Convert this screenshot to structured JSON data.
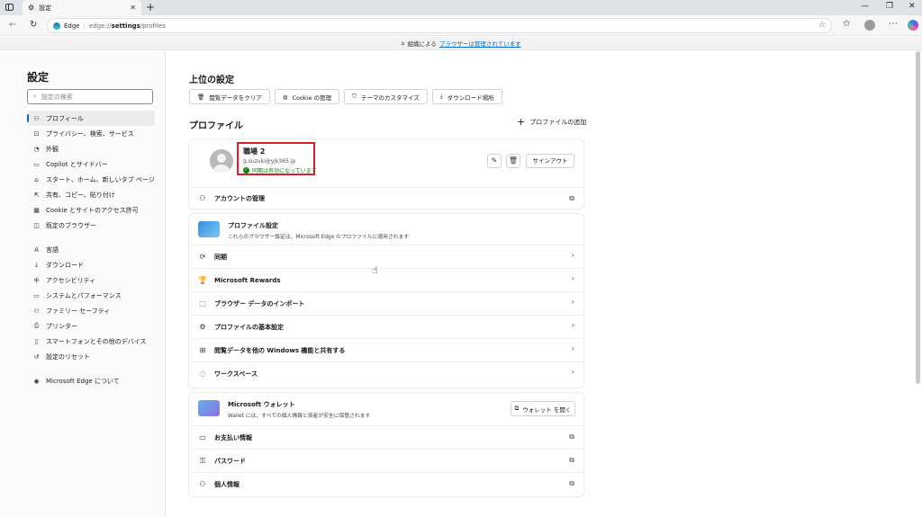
{
  "browser": {
    "tab_title": "設定",
    "tab_close": "✕",
    "new_tab": "+",
    "window_controls": [
      "—",
      "❐",
      "✕"
    ],
    "address": {
      "site": "Edge",
      "url_prefix": "edge://",
      "url_bold": "settings",
      "url_suffix": "/profiles"
    }
  },
  "banner": {
    "prefix": "組織による",
    "link": "ブラウザーは管理されています"
  },
  "sidebar": {
    "title": "設定",
    "search_placeholder": "設定の検索",
    "items": [
      {
        "label": "プロフィール",
        "icon": "person-icon",
        "glyph": "⚇",
        "active": true
      },
      {
        "label": "プライバシー、検索、サービス",
        "icon": "lock-icon",
        "glyph": "⊡"
      },
      {
        "label": "外観",
        "icon": "palette-icon",
        "glyph": "◔"
      },
      {
        "label": "Copilot とサイドバー",
        "icon": "sidebar-icon",
        "glyph": "▭"
      },
      {
        "label": "スタート、ホーム、新しいタブ ページ",
        "icon": "home-icon",
        "glyph": "⌂"
      },
      {
        "label": "共有、コピー、貼り付け",
        "icon": "share-icon",
        "glyph": "⇱"
      },
      {
        "label": "Cookie とサイトのアクセス許可",
        "icon": "permissions-icon",
        "glyph": "▦"
      },
      {
        "label": "既定のブラウザー",
        "icon": "browser-icon",
        "glyph": "◫"
      },
      {
        "label": "言語",
        "icon": "language-icon",
        "glyph": "A",
        "gap_before": true
      },
      {
        "label": "ダウンロード",
        "icon": "download-icon",
        "glyph": "⤓"
      },
      {
        "label": "アクセシビリティ",
        "icon": "accessibility-icon",
        "glyph": "✣"
      },
      {
        "label": "システムとパフォーマンス",
        "icon": "laptop-icon",
        "glyph": "▭"
      },
      {
        "label": "ファミリー セーフティ",
        "icon": "family-icon",
        "glyph": "⚇"
      },
      {
        "label": "プリンター",
        "icon": "printer-icon",
        "glyph": "⎙"
      },
      {
        "label": "スマートフォンとその他のデバイス",
        "icon": "phone-icon",
        "glyph": "▯"
      },
      {
        "label": "設定のリセット",
        "icon": "reset-icon",
        "glyph": "↺"
      },
      {
        "label": "Microsoft Edge について",
        "icon": "edge-icon",
        "glyph": "◉",
        "gap_before": true
      }
    ]
  },
  "main": {
    "top_settings_title": "上位の設定",
    "quick_buttons": [
      {
        "label": "閲覧データをクリア",
        "glyph": "🗑"
      },
      {
        "label": "Cookie の管理",
        "glyph": "◍"
      },
      {
        "label": "テーマのカスタマイズ",
        "glyph": "⛉"
      },
      {
        "label": "ダウンロード場所",
        "glyph": "⤓"
      }
    ],
    "profiles_title": "プロファイル",
    "add_profile": "プロファイルの追加",
    "profile": {
      "name": "職場 2",
      "email": "g.suzuki@yjk365.jp",
      "sync_status": "同期は有効になっています",
      "signout": "サインアウト"
    },
    "manage_account": "アカウントの管理",
    "profile_settings": {
      "title": "プロファイル設定",
      "description": "これらのブラウザー設定は、Microsoft Edge のプロファイルに適用されます",
      "rows": [
        {
          "label": "同期",
          "glyph": "⟳"
        },
        {
          "label": "Microsoft Rewards",
          "glyph": "🏆"
        },
        {
          "label": "ブラウザー データのインポート",
          "glyph": "⬚"
        },
        {
          "label": "プロファイルの基本設定",
          "glyph": "⚙"
        },
        {
          "label": "閲覧データを他の Windows 機能と共有する",
          "glyph": "⊞"
        },
        {
          "label": "ワークスペース",
          "glyph": "◌"
        }
      ]
    },
    "wallet": {
      "title": "Microsoft ウォレット",
      "description": "Wallet には、すべての個人情報と資産が安全に保管されます",
      "open_button": "ウォレット を開く",
      "rows": [
        {
          "label": "お支払い情報",
          "glyph": "▭"
        },
        {
          "label": "パスワード",
          "glyph": "⚿"
        },
        {
          "label": "個人情報",
          "glyph": "⚇"
        }
      ]
    }
  },
  "colors": {
    "accent": "#0f6cbd",
    "highlight_box": "#d6202a",
    "sync_green": "#107c10"
  }
}
